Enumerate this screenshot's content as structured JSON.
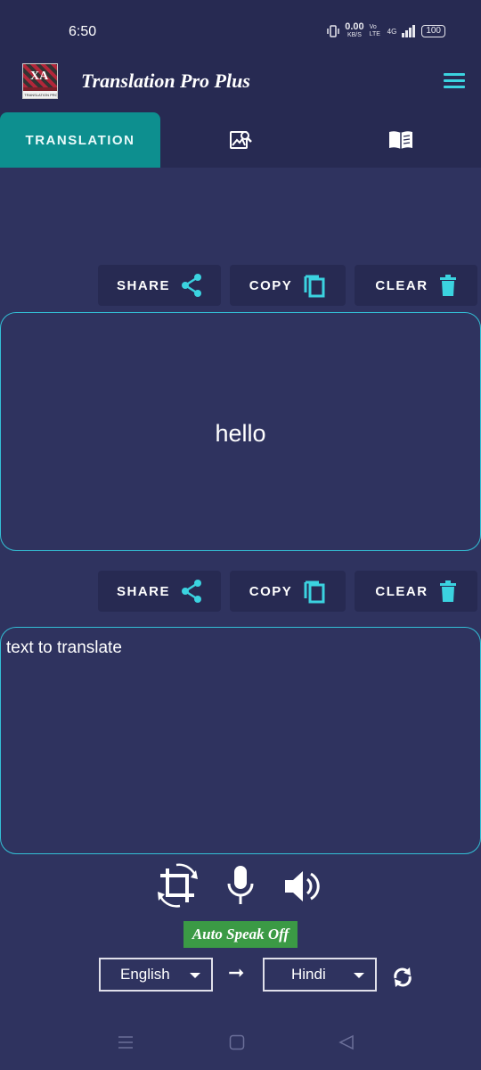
{
  "status_bar": {
    "time": "6:50",
    "net_speed": "0.00",
    "net_unit": "KB/S",
    "volte": "Vo LTE",
    "network": "4G",
    "battery": "100"
  },
  "app": {
    "title": "Translation Pro Plus",
    "logo_text": "XA",
    "logo_caption": "TRANSLATION PRO"
  },
  "tabs": [
    {
      "label": "TRANSLATION",
      "active": true
    },
    {
      "icon": "image-search-icon"
    },
    {
      "icon": "book-icon"
    }
  ],
  "output_actions": {
    "share": "SHARE",
    "copy": "COPY",
    "clear": "CLEAR"
  },
  "output": {
    "text": "hello"
  },
  "input_actions": {
    "share": "SHARE",
    "copy": "COPY",
    "clear": "CLEAR"
  },
  "input": {
    "placeholder": "text to translate"
  },
  "tools": [
    {
      "icon": "crop-rotate-icon"
    },
    {
      "icon": "microphone-icon"
    },
    {
      "icon": "speaker-icon"
    }
  ],
  "auto_speak": "Auto Speak Off",
  "languages": {
    "source": "English",
    "target": "Hindi",
    "arrow": "➞"
  },
  "colors": {
    "background": "#2f335f",
    "bar": "#272a52",
    "accent": "#3bd3e0",
    "active_tab": "#0d8f8f",
    "auto_speak_bg": "#3b9a45"
  }
}
